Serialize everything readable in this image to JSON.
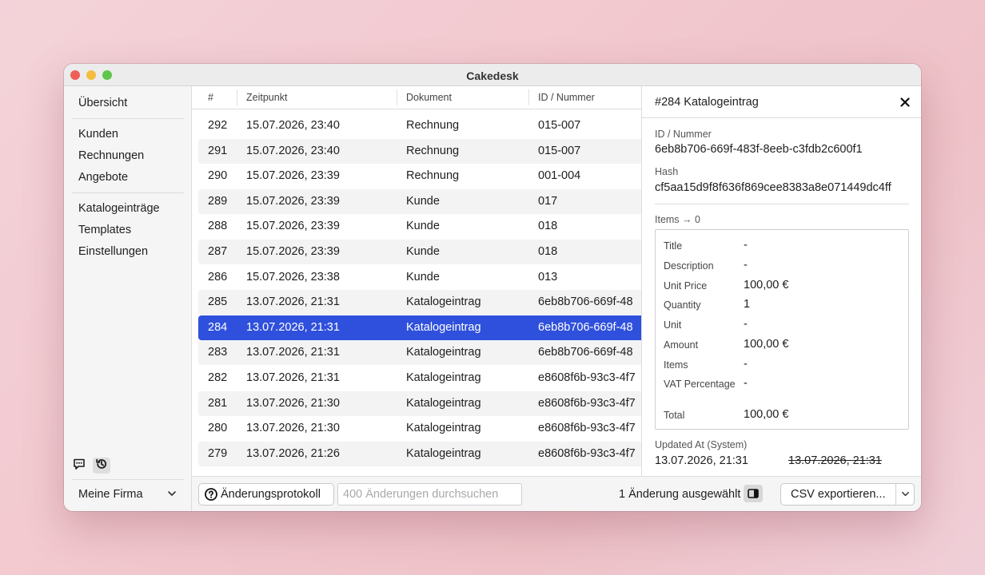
{
  "window": {
    "title": "Cakedesk"
  },
  "sidebar": {
    "overview": "Übersicht",
    "group1": [
      "Kunden",
      "Rechnungen",
      "Angebote"
    ],
    "group2": [
      "Katalogeinträge",
      "Templates",
      "Einstellungen"
    ],
    "company": "Meine Firma"
  },
  "table": {
    "headers": [
      "#",
      "Zeitpunkt",
      "Dokument",
      "ID / Nummer"
    ],
    "rows": [
      {
        "num": "292",
        "time": "15.07.2026, 23:40",
        "doc": "Rechnung",
        "id": "015-007"
      },
      {
        "num": "291",
        "time": "15.07.2026, 23:40",
        "doc": "Rechnung",
        "id": "015-007"
      },
      {
        "num": "290",
        "time": "15.07.2026, 23:39",
        "doc": "Rechnung",
        "id": "001-004"
      },
      {
        "num": "289",
        "time": "15.07.2026, 23:39",
        "doc": "Kunde",
        "id": "017"
      },
      {
        "num": "288",
        "time": "15.07.2026, 23:39",
        "doc": "Kunde",
        "id": "018"
      },
      {
        "num": "287",
        "time": "15.07.2026, 23:39",
        "doc": "Kunde",
        "id": "018"
      },
      {
        "num": "286",
        "time": "15.07.2026, 23:38",
        "doc": "Kunde",
        "id": "013"
      },
      {
        "num": "285",
        "time": "13.07.2026, 21:31",
        "doc": "Katalogeintrag",
        "id": "6eb8b706-669f-48"
      },
      {
        "num": "284",
        "time": "13.07.2026, 21:31",
        "doc": "Katalogeintrag",
        "id": "6eb8b706-669f-48"
      },
      {
        "num": "283",
        "time": "13.07.2026, 21:31",
        "doc": "Katalogeintrag",
        "id": "6eb8b706-669f-48"
      },
      {
        "num": "282",
        "time": "13.07.2026, 21:31",
        "doc": "Katalogeintrag",
        "id": "e8608f6b-93c3-4f7"
      },
      {
        "num": "281",
        "time": "13.07.2026, 21:30",
        "doc": "Katalogeintrag",
        "id": "e8608f6b-93c3-4f7"
      },
      {
        "num": "280",
        "time": "13.07.2026, 21:30",
        "doc": "Katalogeintrag",
        "id": "e8608f6b-93c3-4f7"
      },
      {
        "num": "279",
        "time": "13.07.2026, 21:26",
        "doc": "Katalogeintrag",
        "id": "e8608f6b-93c3-4f7"
      }
    ],
    "selected_num": "284"
  },
  "detail": {
    "title": "#284 Katalogeintrag",
    "id_label": "ID / Nummer",
    "id_value": "6eb8b706-669f-483f-8eeb-c3fdb2c600f1",
    "hash_label": "Hash",
    "hash_value": "cf5aa15d9f8f636f869cee8383a8e071449dc4ff",
    "items_label": "Items → 0",
    "fields": [
      {
        "key": "Title",
        "value": "-"
      },
      {
        "key": "Description",
        "value": "-"
      },
      {
        "key": "Unit Price",
        "value": "100,00 €"
      },
      {
        "key": "Quantity",
        "value": "1"
      },
      {
        "key": "Unit",
        "value": "-"
      },
      {
        "key": "Amount",
        "value": "100,00 €"
      },
      {
        "key": "Items",
        "value": "-"
      },
      {
        "key": "VAT Percentage",
        "value": "-"
      },
      {
        "key": "Total",
        "value": "100,00 €"
      }
    ],
    "updated_label": "Updated At (System)",
    "updated_new": "13.07.2026, 21:31",
    "updated_old": "13.07.2026, 21:31"
  },
  "bottom": {
    "changelog_label": "Änderungsprotokoll",
    "search_placeholder": "400 Änderungen durchsuchen",
    "status": "1 Änderung ausgewählt",
    "export_label": "CSV exportieren..."
  },
  "icons": {
    "feedback": "speech-bubble-icon",
    "history": "history-icon",
    "help": "question-circle-icon",
    "panel": "sidebar-panel-icon",
    "close": "close-icon",
    "chevron": "chevron-down-icon"
  },
  "colors": {
    "selection": "#2f50dc",
    "alt_row": "#f3f3f3"
  }
}
